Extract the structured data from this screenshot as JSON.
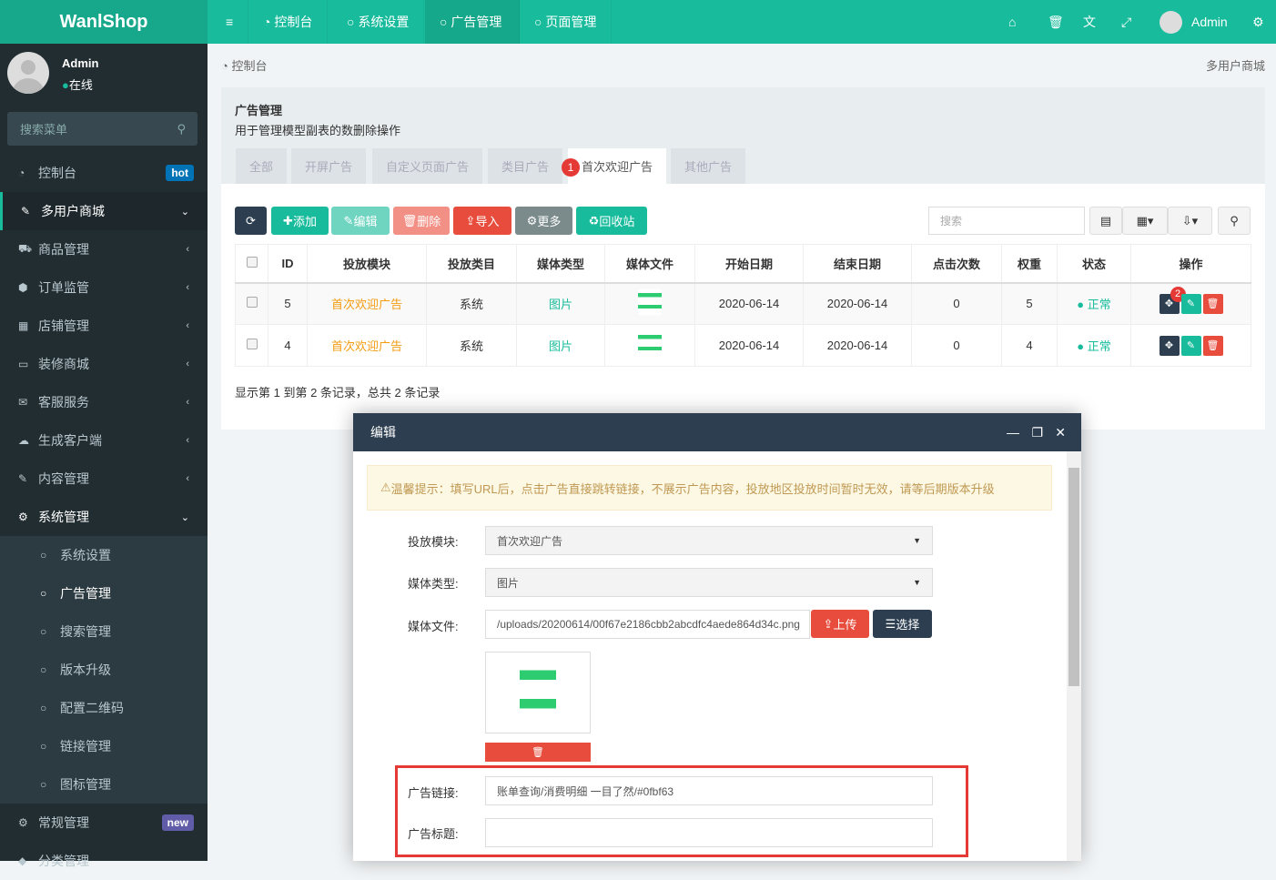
{
  "app": {
    "logo": "WanlShop"
  },
  "topnav": {
    "items": [
      {
        "label": "控制台"
      },
      {
        "label": "系统设置"
      },
      {
        "label": "广告管理"
      },
      {
        "label": "页面管理"
      }
    ],
    "user": "Admin"
  },
  "sidebar": {
    "user": {
      "name": "Admin",
      "status": "在线"
    },
    "search_placeholder": "搜索菜单",
    "items": [
      {
        "label": "控制台",
        "badge": "hot"
      },
      {
        "label": "多用户商城"
      },
      {
        "label": "商品管理"
      },
      {
        "label": "订单监管"
      },
      {
        "label": "店铺管理"
      },
      {
        "label": "装修商城"
      },
      {
        "label": "客服服务"
      },
      {
        "label": "生成客户端"
      },
      {
        "label": "内容管理"
      },
      {
        "label": "系统管理"
      },
      {
        "label": "系统设置"
      },
      {
        "label": "广告管理"
      },
      {
        "label": "搜索管理"
      },
      {
        "label": "版本升级"
      },
      {
        "label": "配置二维码"
      },
      {
        "label": "链接管理"
      },
      {
        "label": "图标管理"
      },
      {
        "label": "常规管理",
        "badge": "new"
      },
      {
        "label": "分类管理"
      }
    ]
  },
  "breadcrumb": {
    "home": "控制台",
    "right": "多用户商城"
  },
  "panel": {
    "title": "广告管理",
    "desc": "用于管理模型副表的数删除操作",
    "tabs": [
      "全部",
      "开屏广告",
      "自定义页面广告",
      "类目广告",
      "首次欢迎广告",
      "其他广告"
    ],
    "toolbar": {
      "add": "添加",
      "edit": "编辑",
      "delete": "删除",
      "import": "导入",
      "more": "更多",
      "recycle": "回收站",
      "search_placeholder": "搜索"
    },
    "columns": [
      "ID",
      "投放模块",
      "投放类目",
      "媒体类型",
      "媒体文件",
      "开始日期",
      "结束日期",
      "点击次数",
      "权重",
      "状态",
      "操作"
    ],
    "rows": [
      {
        "id": "5",
        "module": "首次欢迎广告",
        "category": "系统",
        "media_type": "图片",
        "start": "2020-06-14",
        "end": "2020-06-14",
        "clicks": "0",
        "weight": "5",
        "status": "正常"
      },
      {
        "id": "4",
        "module": "首次欢迎广告",
        "category": "系统",
        "media_type": "图片",
        "start": "2020-06-14",
        "end": "2020-06-14",
        "clicks": "0",
        "weight": "4",
        "status": "正常"
      }
    ],
    "footer": "显示第 1 到第 2 条记录，总共 2 条记录",
    "markers": [
      "1",
      "2"
    ]
  },
  "modal": {
    "title": "编辑",
    "warning": "温馨提示：填写URL后，点击广告直接跳转链接，不展示广告内容，投放地区投放时间暂时无效，请等后期版本升级",
    "fields": {
      "module_label": "投放模块:",
      "module_value": "首次欢迎广告",
      "type_label": "媒体类型:",
      "type_value": "图片",
      "file_label": "媒体文件:",
      "file_value": "/uploads/20200614/00f67e2186cbb2abcdfc4aede864d34c.png",
      "upload": "上传",
      "choose": "选择",
      "link_label": "广告链接:",
      "link_value": "账单查询/消费明细 一目了然/#0fbf63",
      "title_label": "广告标题:",
      "title_value": ""
    }
  }
}
